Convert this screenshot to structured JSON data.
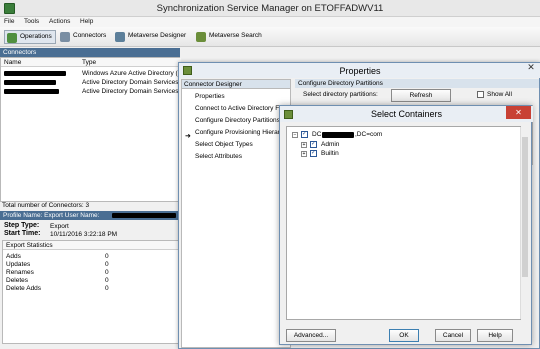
{
  "app": {
    "title": "Synchronization Service Manager on ETOFFADWV11"
  },
  "menu": [
    "File",
    "Tools",
    "Actions",
    "Help"
  ],
  "toolbar": {
    "items": [
      "Operations",
      "Connectors",
      "Metaverse Designer",
      "Metaverse Search"
    ]
  },
  "connectors": {
    "header": "Connectors",
    "columns": [
      "Name",
      "Type"
    ],
    "rows": [
      {
        "type": "Windows Azure Active Directory (Mic"
      },
      {
        "type": "Active Directory Domain Services"
      },
      {
        "type": "Active Directory Domain Services"
      }
    ],
    "total": "Total number of Connectors: 3"
  },
  "profile": {
    "header": "Profile Name: Export  User Name:",
    "step_type_label": "Step Type:",
    "step_type_value": "Export",
    "start_time_label": "Start Time:",
    "start_time_value": "10/11/2016 3:22:18 PM"
  },
  "stats": {
    "header": "Export Statistics",
    "rows": [
      {
        "label": "Adds",
        "value": "0"
      },
      {
        "label": "Updates",
        "value": "0"
      },
      {
        "label": "Renames",
        "value": "0"
      },
      {
        "label": "Deletes",
        "value": "0"
      },
      {
        "label": "Delete Adds",
        "value": "0"
      }
    ]
  },
  "properties": {
    "title": "Properties",
    "designer_header": "Connector Designer",
    "designer_items": [
      "Properties",
      "Connect to Active Directory Forest",
      "Configure Directory Partitions",
      "Configure Provisioning Hierarchy",
      "Select Object Types",
      "Select Attributes"
    ],
    "active_item": "Configure Directory Partitions",
    "config_header": "Configure Directory Partitions",
    "select_label": "Select directory partitions:",
    "refresh_label": "Refresh",
    "show_all_label": "Show All"
  },
  "select_containers": {
    "title": "Select Containers",
    "root_prefix": "DC",
    "root_suffix": ",DC=com",
    "children": [
      "Admin",
      "Builtin"
    ],
    "buttons": {
      "advanced": "Advanced...",
      "ok": "OK",
      "cancel": "Cancel",
      "help": "Help"
    }
  }
}
